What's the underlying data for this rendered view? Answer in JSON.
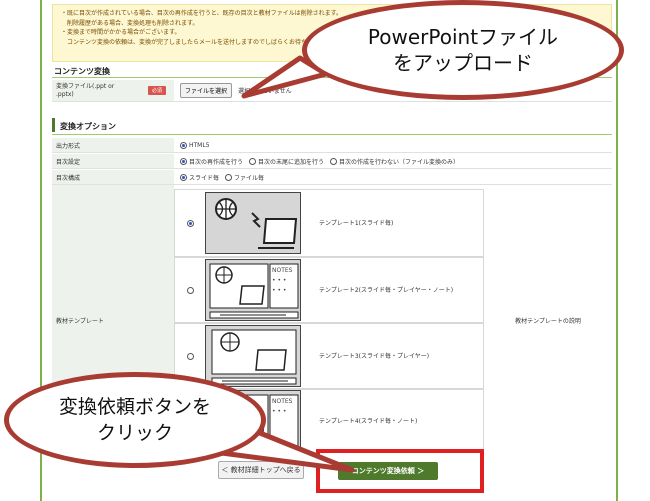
{
  "notice": {
    "lines": [
      "・既に目次が作成されている場合、目次の再作成を行うと、既存の目次と教材ファイルは削除されます。",
      "　削除履歴がある場合、変換処理も削除されます。",
      "・変換まで時間がかかる場合がございます。",
      "　コンテンツ変換の依頼は、変換が完了しましたらメールを送付しますのでしばらくお待ちください。"
    ]
  },
  "convert": {
    "section_title": "コンテンツ変換",
    "file_label": "変換ファイル(.ppt or .pptx)",
    "required_badge": "必須",
    "file_button": "ファイルを選択",
    "file_status": "選択されていません"
  },
  "options": {
    "section_title": "変換オプション",
    "output_label": "出力形式",
    "output_value": "HTML5",
    "toc_label": "目次設定",
    "toc_options": [
      "目次の再作成を行う",
      "目次の末尾に追加を行う",
      "目次の作成を行わない（ファイル変換のみ）"
    ],
    "composition_label": "目次構成",
    "composition_options": [
      "スライド毎",
      "ファイル毎"
    ],
    "template_label": "教材テンプレート",
    "template_desc": "教材テンプレートの説明",
    "templates": [
      {
        "name": "テンプレート1(スライド毎)",
        "selected": true
      },
      {
        "name": "テンプレート2(スライド毎・プレイヤー・ノート)",
        "selected": false
      },
      {
        "name": "テンプレート3(スライド毎・プレイヤー)",
        "selected": false
      },
      {
        "name": "テンプレート4(スライド毎・ノート)",
        "selected": false
      }
    ],
    "notes_label": "NOTES"
  },
  "actions": {
    "back_button": "＜ 教材詳細トップへ戻る",
    "submit_button": "コンテンツ変換依頼 ＞"
  },
  "callouts": {
    "upload": "PowerPointファイル\nをアップロード",
    "click": "変換依頼ボタンを\nクリック"
  },
  "colors": {
    "accent_green": "#4f7a2c",
    "callout_border": "#a83b32",
    "highlight_red": "#e02020",
    "required_red": "#d9534f"
  }
}
